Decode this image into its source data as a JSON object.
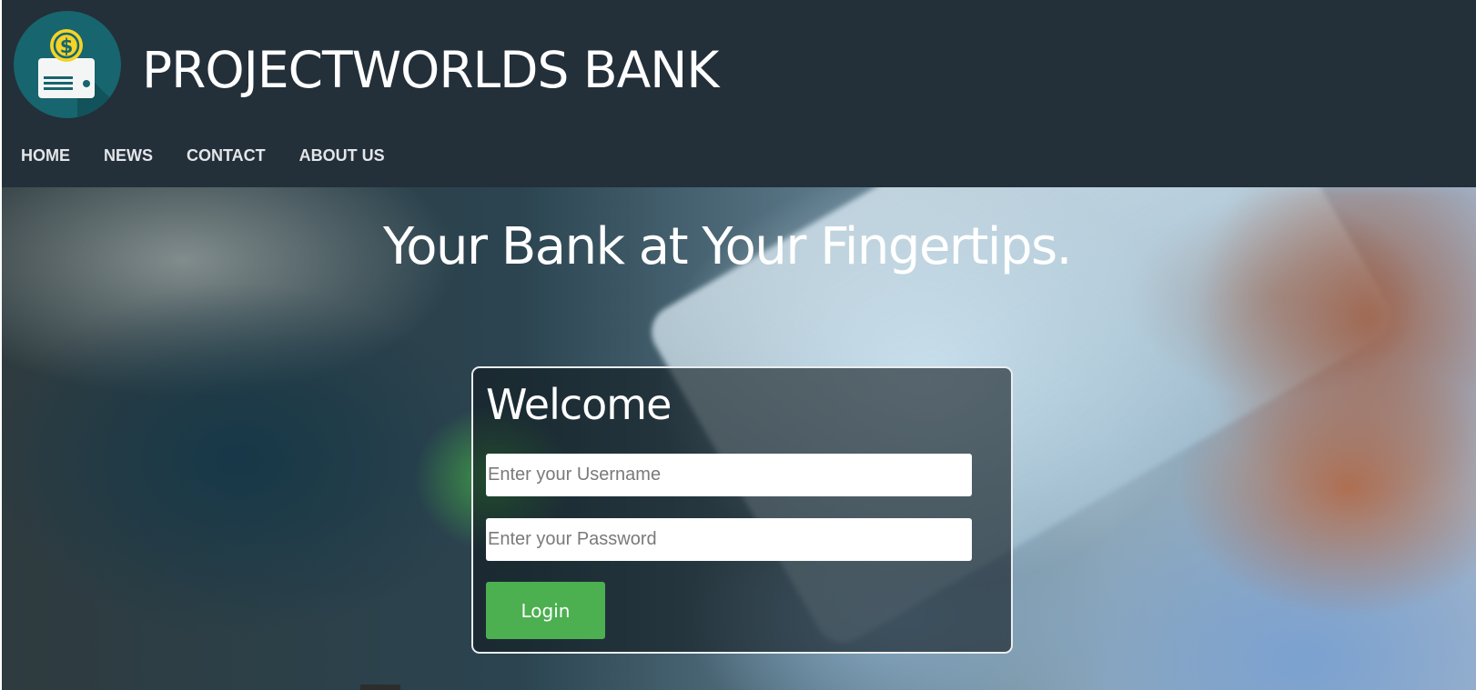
{
  "header": {
    "logo_icon": "dollar-card-icon",
    "brand_title": "PROJECTWORLDS BANK",
    "colors": {
      "background": "#232f39",
      "logo_circle": "#17656e",
      "coin": "#f5d327"
    }
  },
  "nav": {
    "items": [
      {
        "label": "HOME"
      },
      {
        "label": "NEWS"
      },
      {
        "label": "CONTACT"
      },
      {
        "label": "ABOUT US"
      }
    ]
  },
  "hero": {
    "tagline": "Your Bank at Your Fingertips."
  },
  "login": {
    "heading": "Welcome",
    "username_placeholder": "Enter your Username",
    "password_placeholder": "Enter your Password",
    "username_value": "",
    "password_value": "",
    "button_label": "Login",
    "button_color": "#4caf50"
  }
}
